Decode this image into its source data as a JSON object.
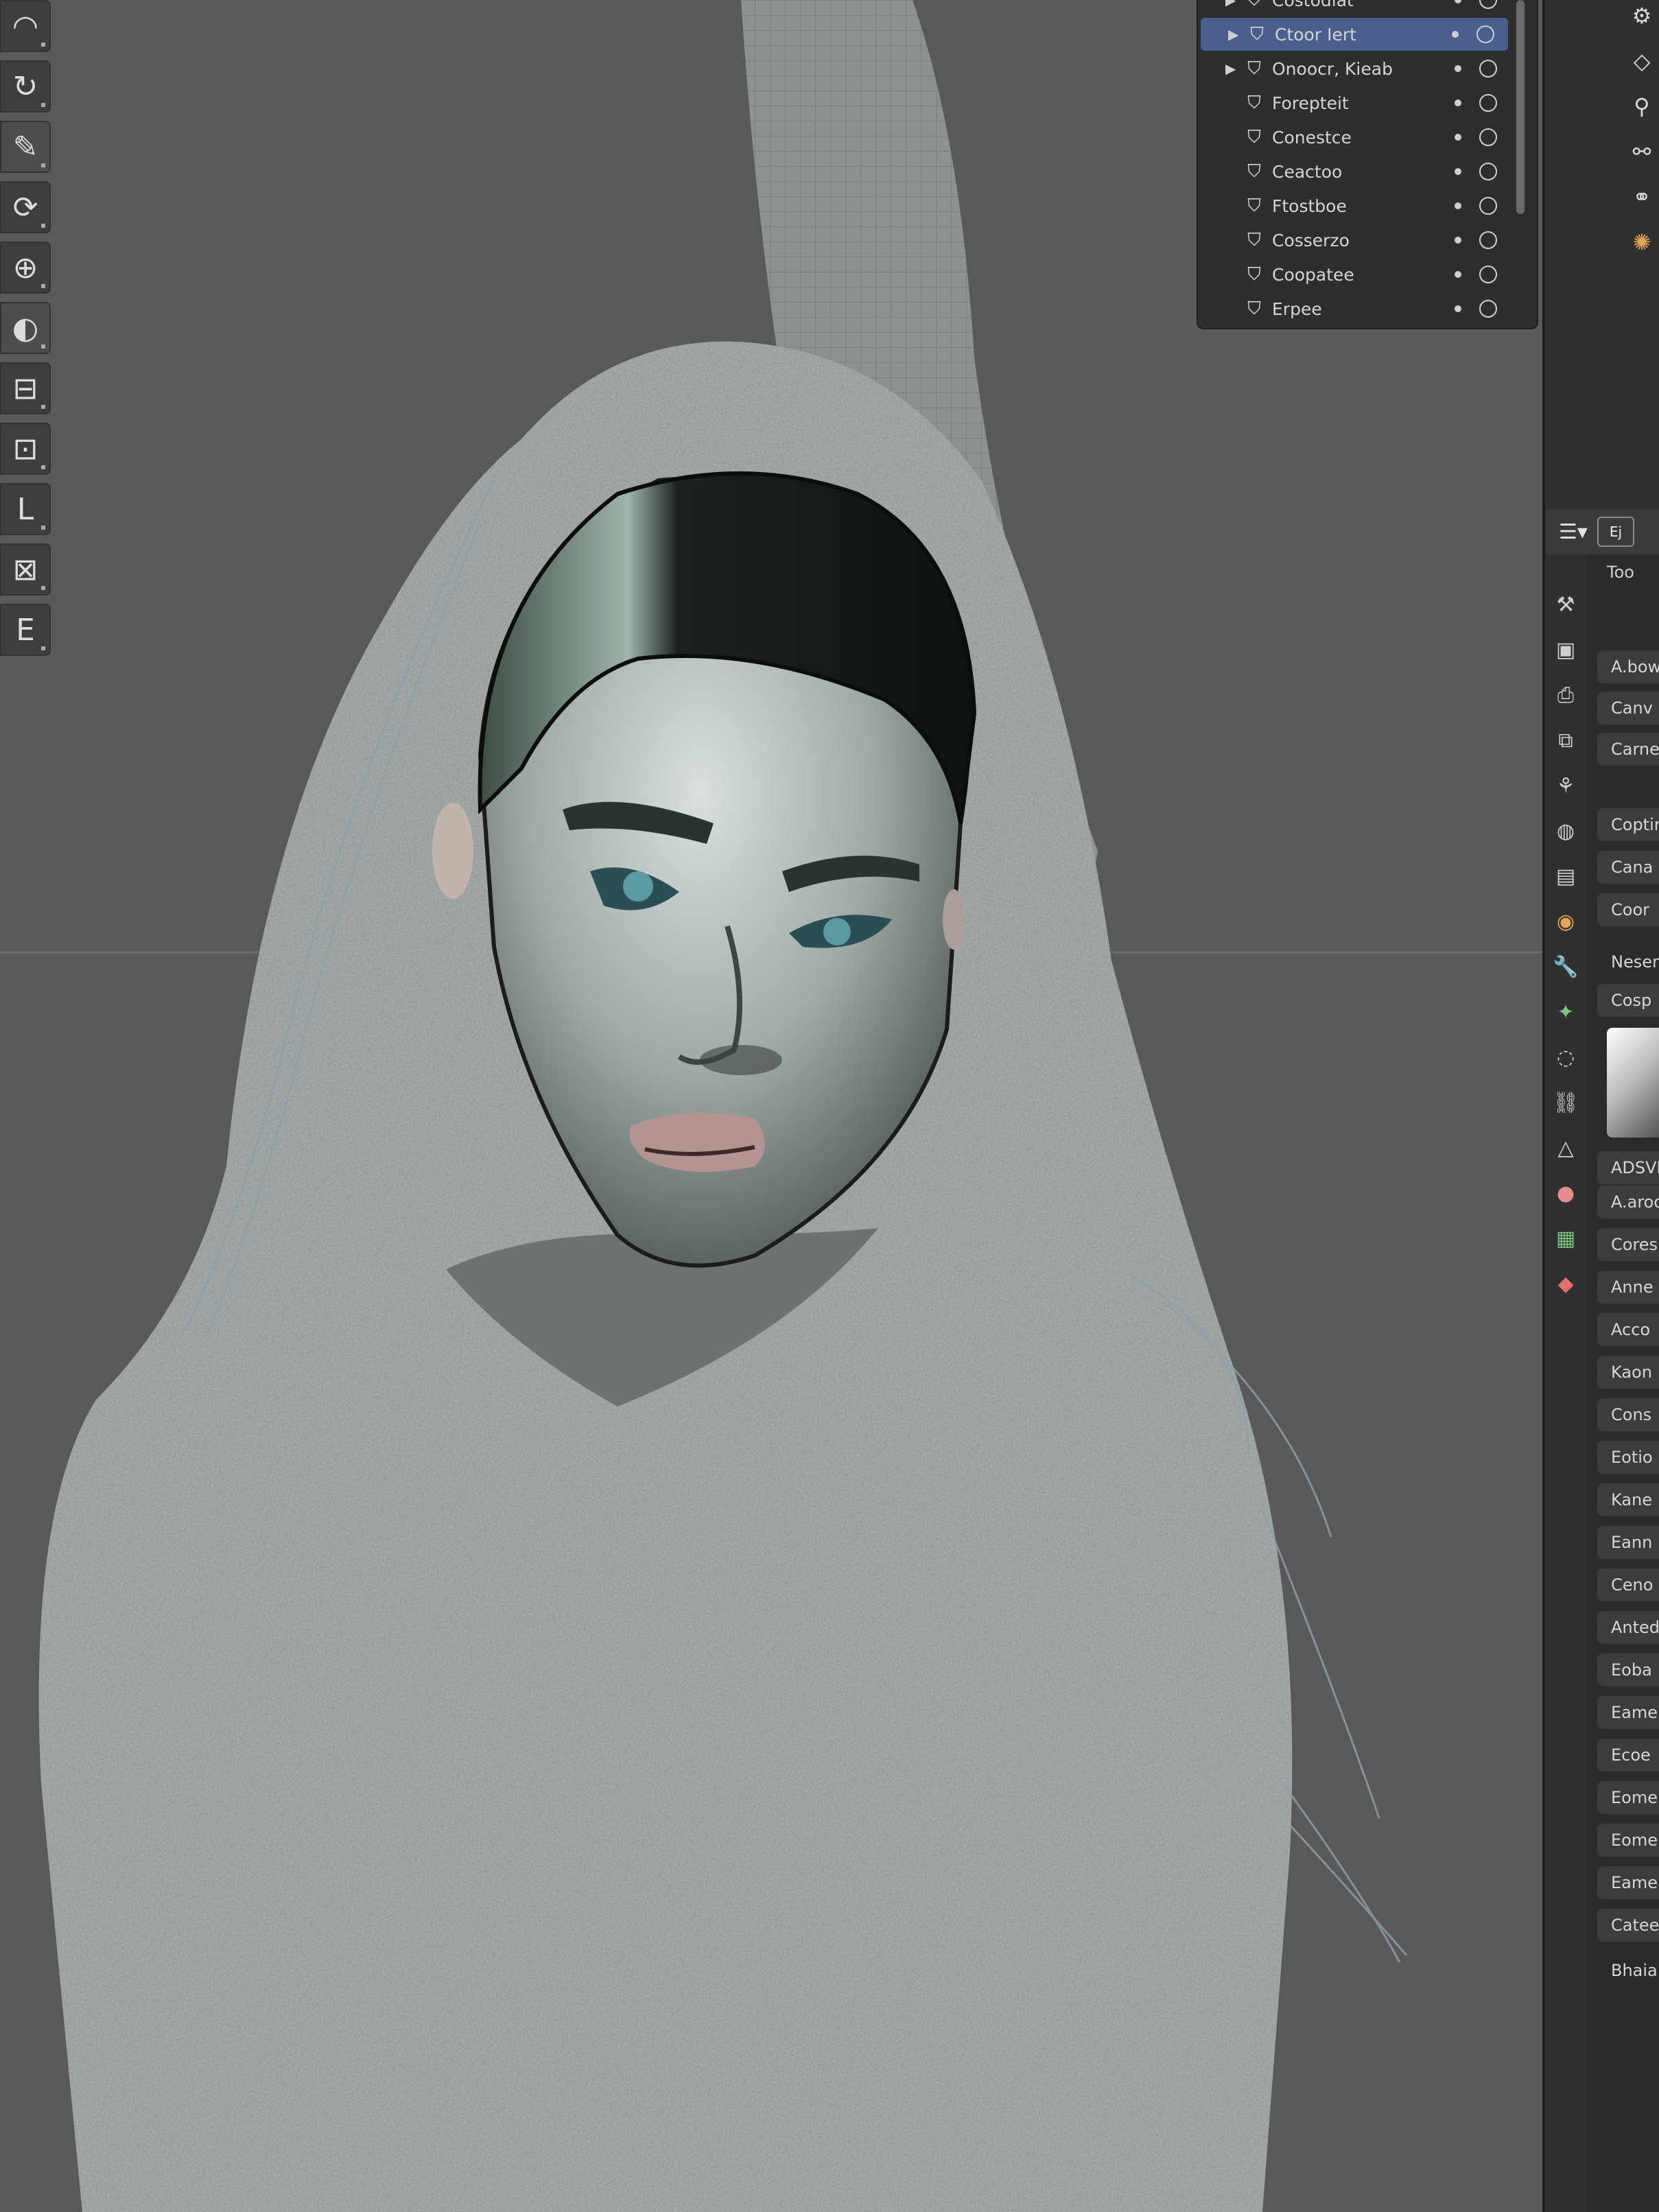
{
  "toolbar": {
    "tools": [
      {
        "icon": "draw-brush-icon"
      },
      {
        "icon": "clay-brush-icon"
      },
      {
        "icon": "inflate-brush-icon",
        "active": true
      },
      {
        "icon": "crease-brush-icon"
      },
      {
        "icon": "blob-brush-icon"
      },
      {
        "icon": "smooth-brush-icon",
        "active": true
      },
      {
        "icon": "flatten-brush-icon"
      },
      {
        "icon": "fill-brush-icon"
      },
      {
        "icon": "grab-brush-icon"
      },
      {
        "icon": "mask-brush-icon"
      },
      {
        "icon": "box-mask-icon"
      }
    ]
  },
  "outliner": {
    "items": [
      {
        "label": "Costodlat",
        "expand": true
      },
      {
        "label": "Ctoor Iert",
        "expand": true,
        "selected": true
      },
      {
        "label": "Onoocr, Kieab",
        "expand": true
      },
      {
        "label": "Forepteit",
        "expand": false
      },
      {
        "label": "Conestce",
        "expand": false
      },
      {
        "label": "Ceactoo",
        "expand": false
      },
      {
        "label": "Ftostboe",
        "expand": false
      },
      {
        "label": "Cosserzo",
        "expand": false
      },
      {
        "label": "Coopatee",
        "expand": false
      },
      {
        "label": "Erpee",
        "expand": false
      }
    ]
  },
  "properties": {
    "header_label": "Ej",
    "search_label": "Too",
    "rows": [
      "A.bow",
      "Canv",
      "Carne",
      "Coptir",
      "Cana",
      "Coor",
      "Nesen",
      "Cosp",
      "ADSVI",
      "A.aroo",
      "Cores",
      "Anne",
      "Acco",
      "Kaon",
      "Cons",
      "Eotio",
      "Kane",
      "Eann",
      "Ceno",
      "Anted",
      "Eoba",
      "Eame",
      "Ecoe",
      "Eome",
      "Eome",
      "Eame",
      "Catee",
      "Bhaia"
    ]
  }
}
